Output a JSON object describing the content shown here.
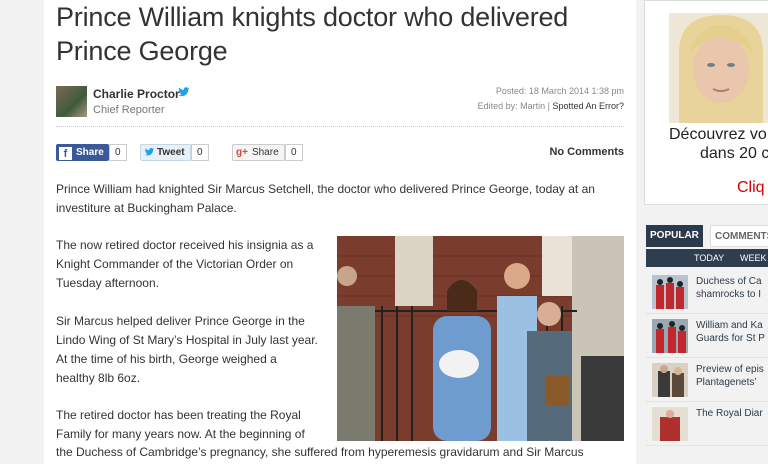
{
  "article": {
    "title_line1": "Prince William knights doctor who delivered",
    "title_line2": "Prince George",
    "author_name": "Charlie Proctor",
    "author_role": "Chief Reporter",
    "posted": "Posted: 18 March 2014 1:38 pm",
    "edited_prefix": "Edited by: Martin | ",
    "spotted_error": "Spotted An Error?",
    "share": {
      "facebook_label": "Share",
      "facebook_count": "0",
      "twitter_label": "Tweet",
      "twitter_count": "0",
      "gplus_icon": "g+",
      "gplus_label": "Share",
      "gplus_count": "0"
    },
    "no_comments": "No Comments",
    "paragraphs": [
      "Prince William had knighted Sir Marcus Setchell, the doctor who delivered Prince George, today at an investiture at Buckingham Palace.",
      "The now retired doctor received his insignia as a Knight Commander of the Victorian Order on Tuesday afternoon.",
      "Sir Marcus helped deliver Prince George in the Lindo Wing of St Mary’s Hospital in July last year. At the time of his birth, George weighed a healthy 8lb 6oz.",
      "The retired doctor has been treating the Royal Family for many years now. At the beginning of",
      "the Duchess of Cambridge’s pregnancy, she suffered from hyperemesis gravidarum and Sir Marcus"
    ]
  },
  "ad": {
    "line1": "Découvrez vo",
    "line2": "dans 20 c",
    "cta": "Cliq"
  },
  "sidebar": {
    "tabs": [
      "POPULAR",
      "COMMENTS"
    ],
    "subtabs": [
      "TODAY",
      "WEEK"
    ],
    "popular": [
      {
        "line1": "Duchess of Ca",
        "line2": "shamrocks to I"
      },
      {
        "line1": "William and Ka",
        "line2": "Guards for St P"
      },
      {
        "line1": "Preview of epis",
        "line2": "Plantagenets’"
      },
      {
        "line1": "The Royal Diar",
        "line2": ""
      }
    ]
  },
  "colors": {
    "facebook": "#3b5998",
    "twitter": "#1da1f2",
    "popular_tab": "#2b3a4a",
    "ad_cta": "#d40000"
  }
}
